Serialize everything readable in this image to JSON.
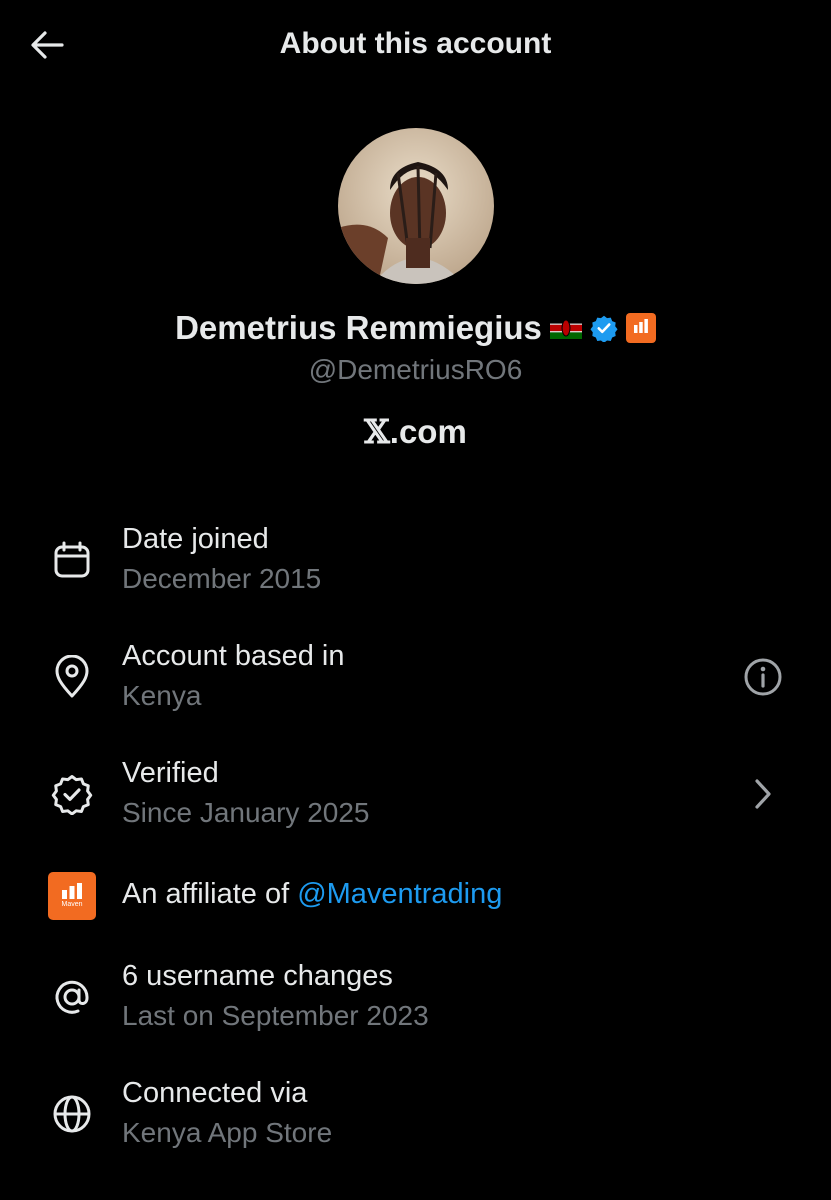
{
  "header": {
    "title": "About this account",
    "back_icon": "arrow-left-icon"
  },
  "profile": {
    "display_name": "Demetrius Remmiegius",
    "flag": "🇰🇪",
    "handle": "@DemetriusRO6",
    "site_logo": "𝕏",
    "site_suffix": ".com"
  },
  "details": {
    "date_joined": {
      "title": "Date joined",
      "value": "December 2015",
      "icon": "calendar-icon"
    },
    "based_in": {
      "title": "Account based in",
      "value": "Kenya",
      "icon": "location-pin-icon",
      "action_icon": "info-icon"
    },
    "verified": {
      "title": "Verified",
      "value": "Since January 2025",
      "icon": "verified-badge-icon",
      "action_icon": "chevron-right-icon"
    },
    "affiliate": {
      "prefix": "An affiliate of ",
      "link": "@Maventrading",
      "icon": "maven-logo",
      "logo_text": "Maven"
    },
    "username_changes": {
      "title": "6 username changes",
      "value": "Last on September 2023",
      "icon": "at-sign-icon"
    },
    "connected": {
      "title": "Connected via",
      "value": "Kenya App Store",
      "icon": "globe-icon"
    }
  },
  "colors": {
    "background": "#000000",
    "text": "#e7e9ea",
    "muted": "#71767b",
    "link": "#1d9bf0",
    "verified": "#1d9bf0",
    "maven": "#f26b21"
  }
}
